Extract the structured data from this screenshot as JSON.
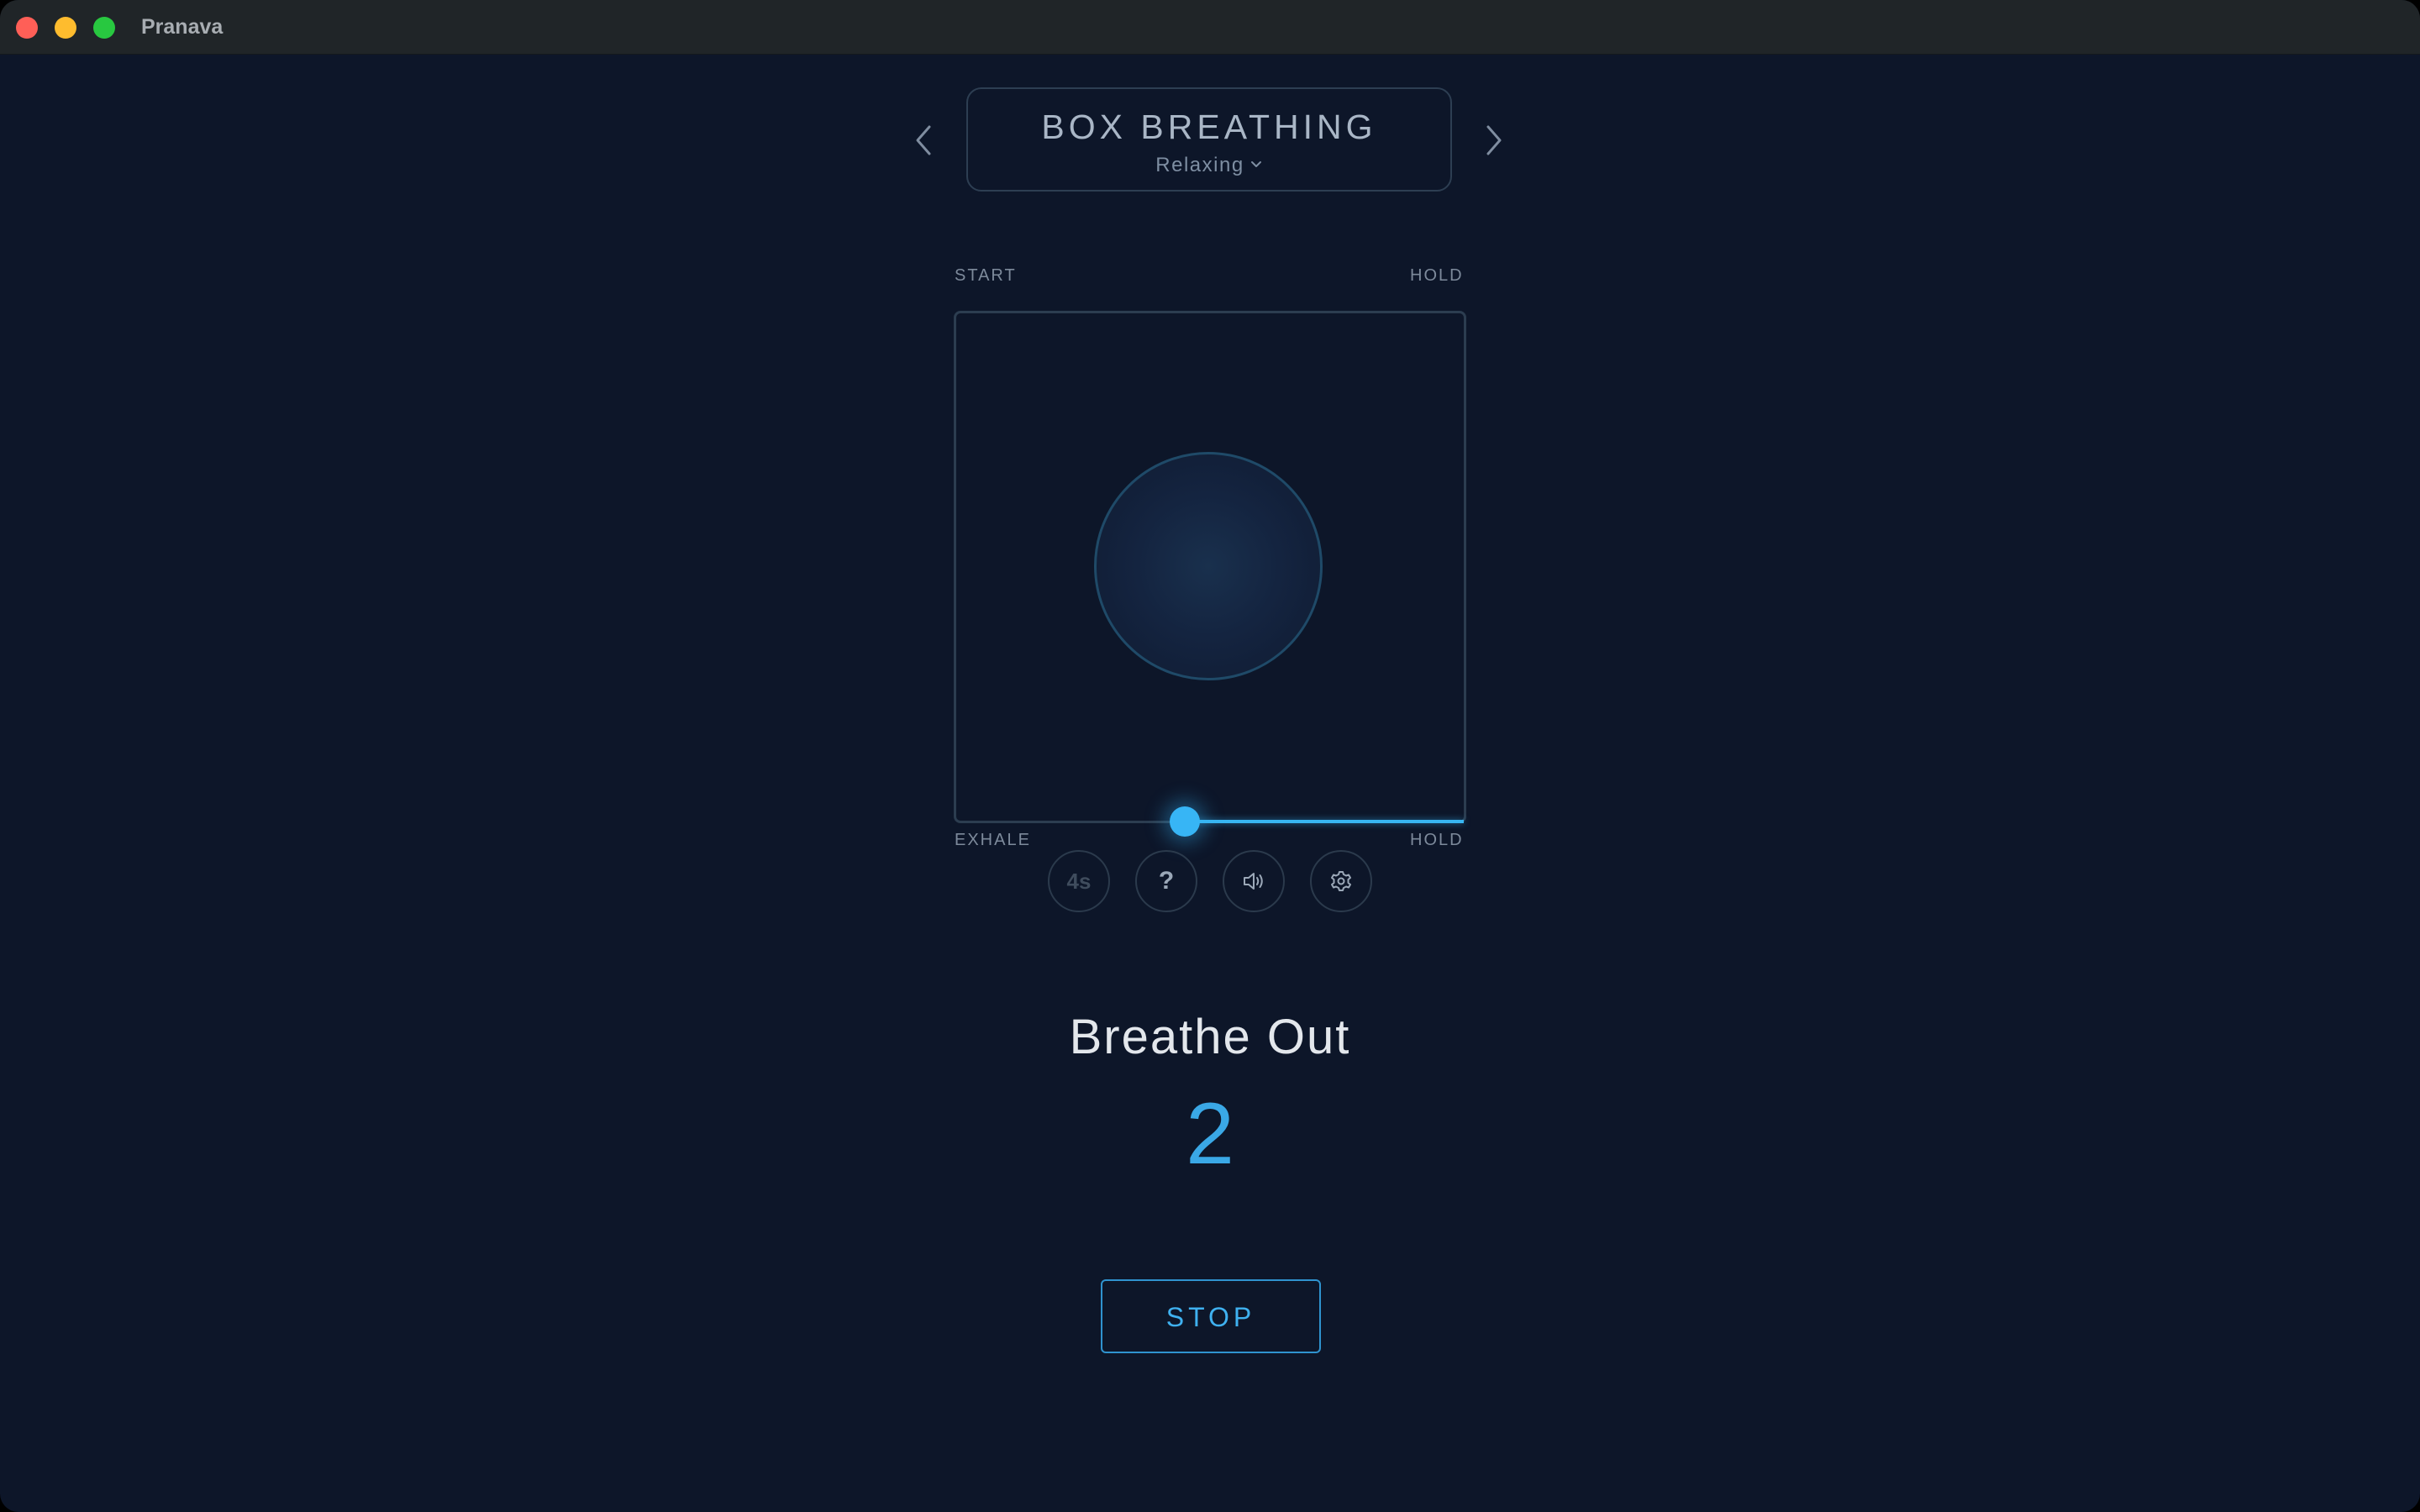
{
  "window": {
    "title": "Pranava",
    "traffic_colors": {
      "close": "#ff5f57",
      "minimize": "#febc2e",
      "maximize": "#28c840"
    }
  },
  "exercise": {
    "title": "BOX BREATHING",
    "mode": "Relaxing"
  },
  "box_labels": {
    "top_left": "START",
    "top_right": "HOLD",
    "bottom_left": "EXHALE",
    "bottom_right": "HOLD"
  },
  "phase_progress": 0.55,
  "controls": {
    "duration_label": "4s",
    "help_label": "?"
  },
  "phase": {
    "label": "Breathe Out",
    "count": "2"
  },
  "stop_label": "STOP",
  "colors": {
    "background": "#0d1629",
    "accent": "#38b6f2",
    "border": "#2c3d50"
  }
}
